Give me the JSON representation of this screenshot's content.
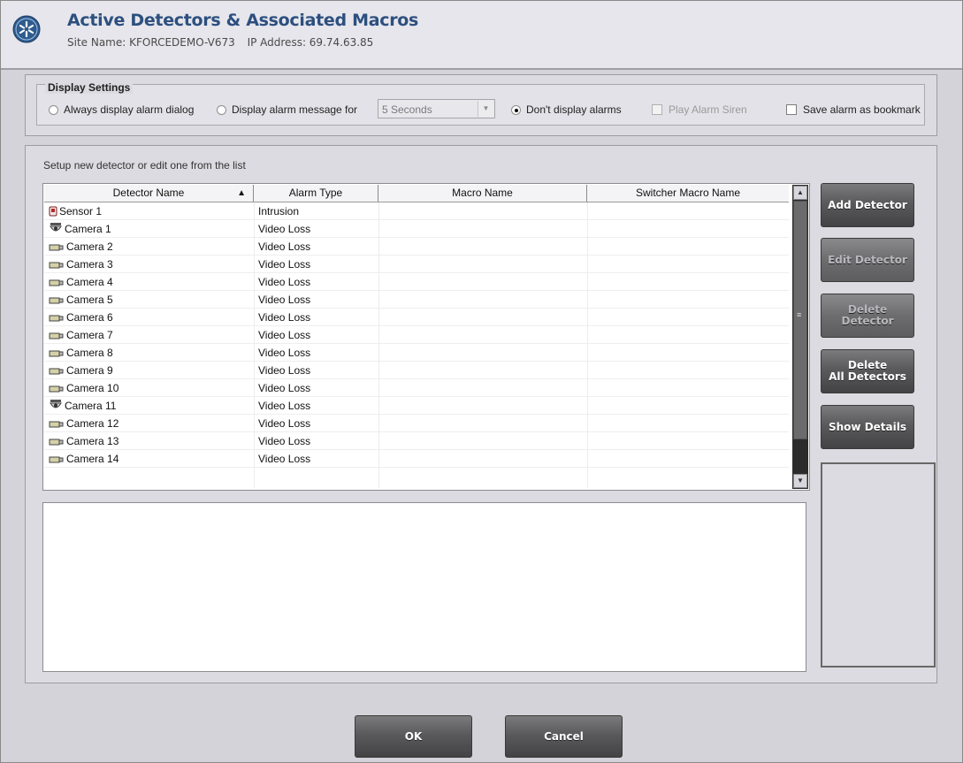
{
  "header": {
    "title": "Active Detectors & Associated Macros",
    "site_name": "Site Name: KFORCEDEMO-V673",
    "ip_address": "IP Address: 69.74.63.85"
  },
  "display_settings": {
    "legend": "Display Settings",
    "options": {
      "always_dialog": "Always display alarm dialog",
      "display_message_for": "Display alarm message for",
      "duration_value": "5 Seconds",
      "dont_display": "Don't display alarms",
      "play_siren": "Play Alarm Siren",
      "save_bookmark": "Save alarm as bookmark"
    },
    "selected": "dont_display"
  },
  "main": {
    "caption": "Setup new detector or edit one from the  list",
    "table": {
      "columns": [
        "Detector Name",
        "Alarm Type",
        "Macro Name",
        "Switcher Macro Name"
      ],
      "sort_indicator": "▲",
      "rows": [
        {
          "icon": "sensor-icon",
          "name": "Sensor  1",
          "alarm": "Intrusion"
        },
        {
          "icon": "dome-camera-icon",
          "name": "Camera 1",
          "alarm": "Video Loss"
        },
        {
          "icon": "camera-icon",
          "name": "Camera 2",
          "alarm": "Video Loss"
        },
        {
          "icon": "camera-icon",
          "name": "Camera 3",
          "alarm": "Video Loss"
        },
        {
          "icon": "camera-icon",
          "name": "Camera  4",
          "alarm": "Video Loss"
        },
        {
          "icon": "camera-icon",
          "name": "Camera  5",
          "alarm": "Video Loss"
        },
        {
          "icon": "camera-icon",
          "name": "Camera  6",
          "alarm": "Video Loss"
        },
        {
          "icon": "camera-icon",
          "name": "Camera  7",
          "alarm": "Video Loss"
        },
        {
          "icon": "camera-icon",
          "name": "Camera  8",
          "alarm": "Video Loss"
        },
        {
          "icon": "camera-icon",
          "name": "Camera  9",
          "alarm": "Video Loss"
        },
        {
          "icon": "camera-icon",
          "name": "Camera 10",
          "alarm": "Video Loss"
        },
        {
          "icon": "dome-camera-icon",
          "name": "Camera 11",
          "alarm": "Video Loss"
        },
        {
          "icon": "camera-icon",
          "name": "Camera 12",
          "alarm": "Video Loss"
        },
        {
          "icon": "camera-icon",
          "name": "Camera 13",
          "alarm": "Video Loss"
        },
        {
          "icon": "camera-icon",
          "name": "Camera 14",
          "alarm": "Video Loss"
        }
      ]
    }
  },
  "side_buttons": {
    "add": "Add Detector",
    "edit": "Edit Detector",
    "delete": "Delete Detector",
    "delete_all_line1": "Delete",
    "delete_all_line2": "All Detectors",
    "show_details": "Show Details"
  },
  "footer": {
    "ok": "OK",
    "cancel": "Cancel"
  }
}
